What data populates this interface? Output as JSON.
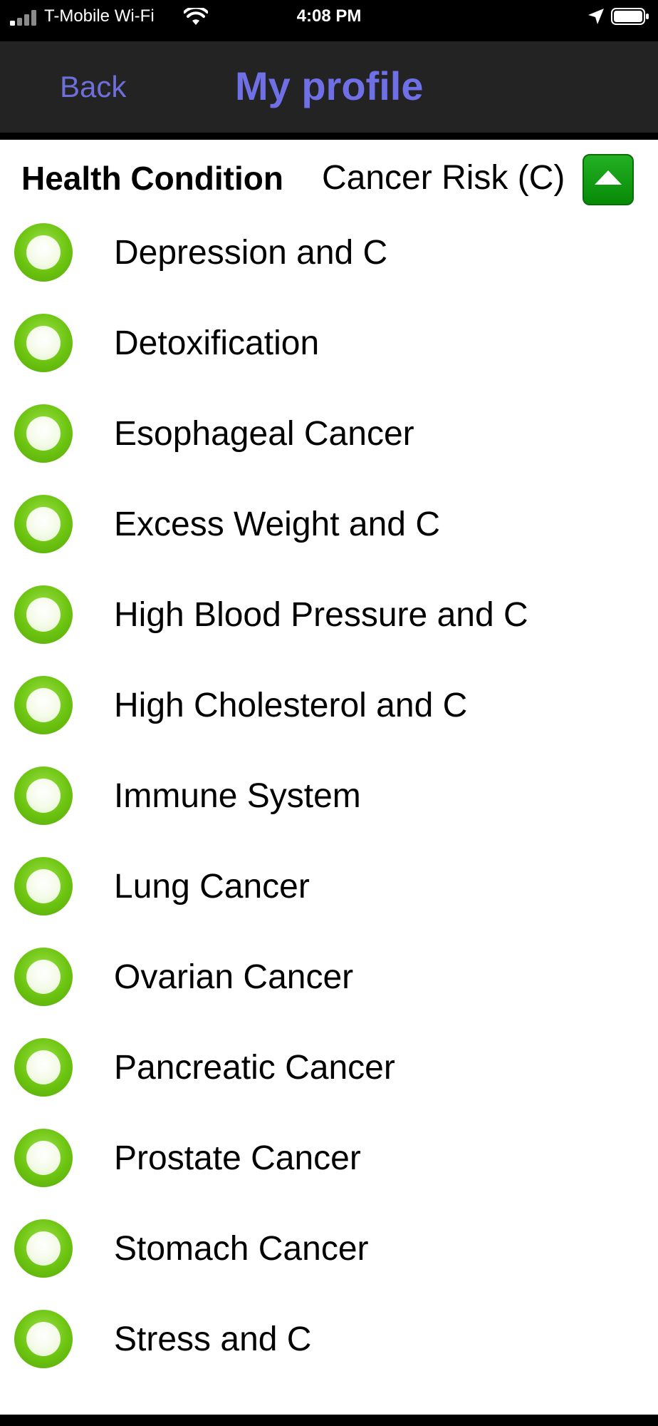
{
  "status_bar": {
    "carrier": "T-Mobile Wi-Fi",
    "time": "4:08 PM",
    "signal_icon": "signal-bars-icon",
    "wifi_icon": "wifi-icon",
    "location_icon": "location-arrow-icon",
    "battery_icon": "battery-icon"
  },
  "nav": {
    "back_label": "Back",
    "title": "My profile"
  },
  "header": {
    "label": "Health Condition",
    "selected_value": "Cancer Risk (C)",
    "collapse_icon": "collapse-up-icon"
  },
  "conditions": [
    {
      "label": ""
    },
    {
      "label": "Depression and C"
    },
    {
      "label": "Detoxification"
    },
    {
      "label": "Esophageal Cancer"
    },
    {
      "label": "Excess Weight and C"
    },
    {
      "label": "High Blood Pressure and C"
    },
    {
      "label": "High Cholesterol and C"
    },
    {
      "label": "Immune System"
    },
    {
      "label": "Lung Cancer"
    },
    {
      "label": "Ovarian Cancer"
    },
    {
      "label": "Pancreatic Cancer"
    },
    {
      "label": "Prostate Cancer"
    },
    {
      "label": "Stomach Cancer"
    },
    {
      "label": "Stress and C"
    }
  ],
  "colors": {
    "nav_background": "#232323",
    "nav_text": "#6e6fd8",
    "radio_green": "#6cc410",
    "collapse_button_green": "#0a9a0a"
  }
}
